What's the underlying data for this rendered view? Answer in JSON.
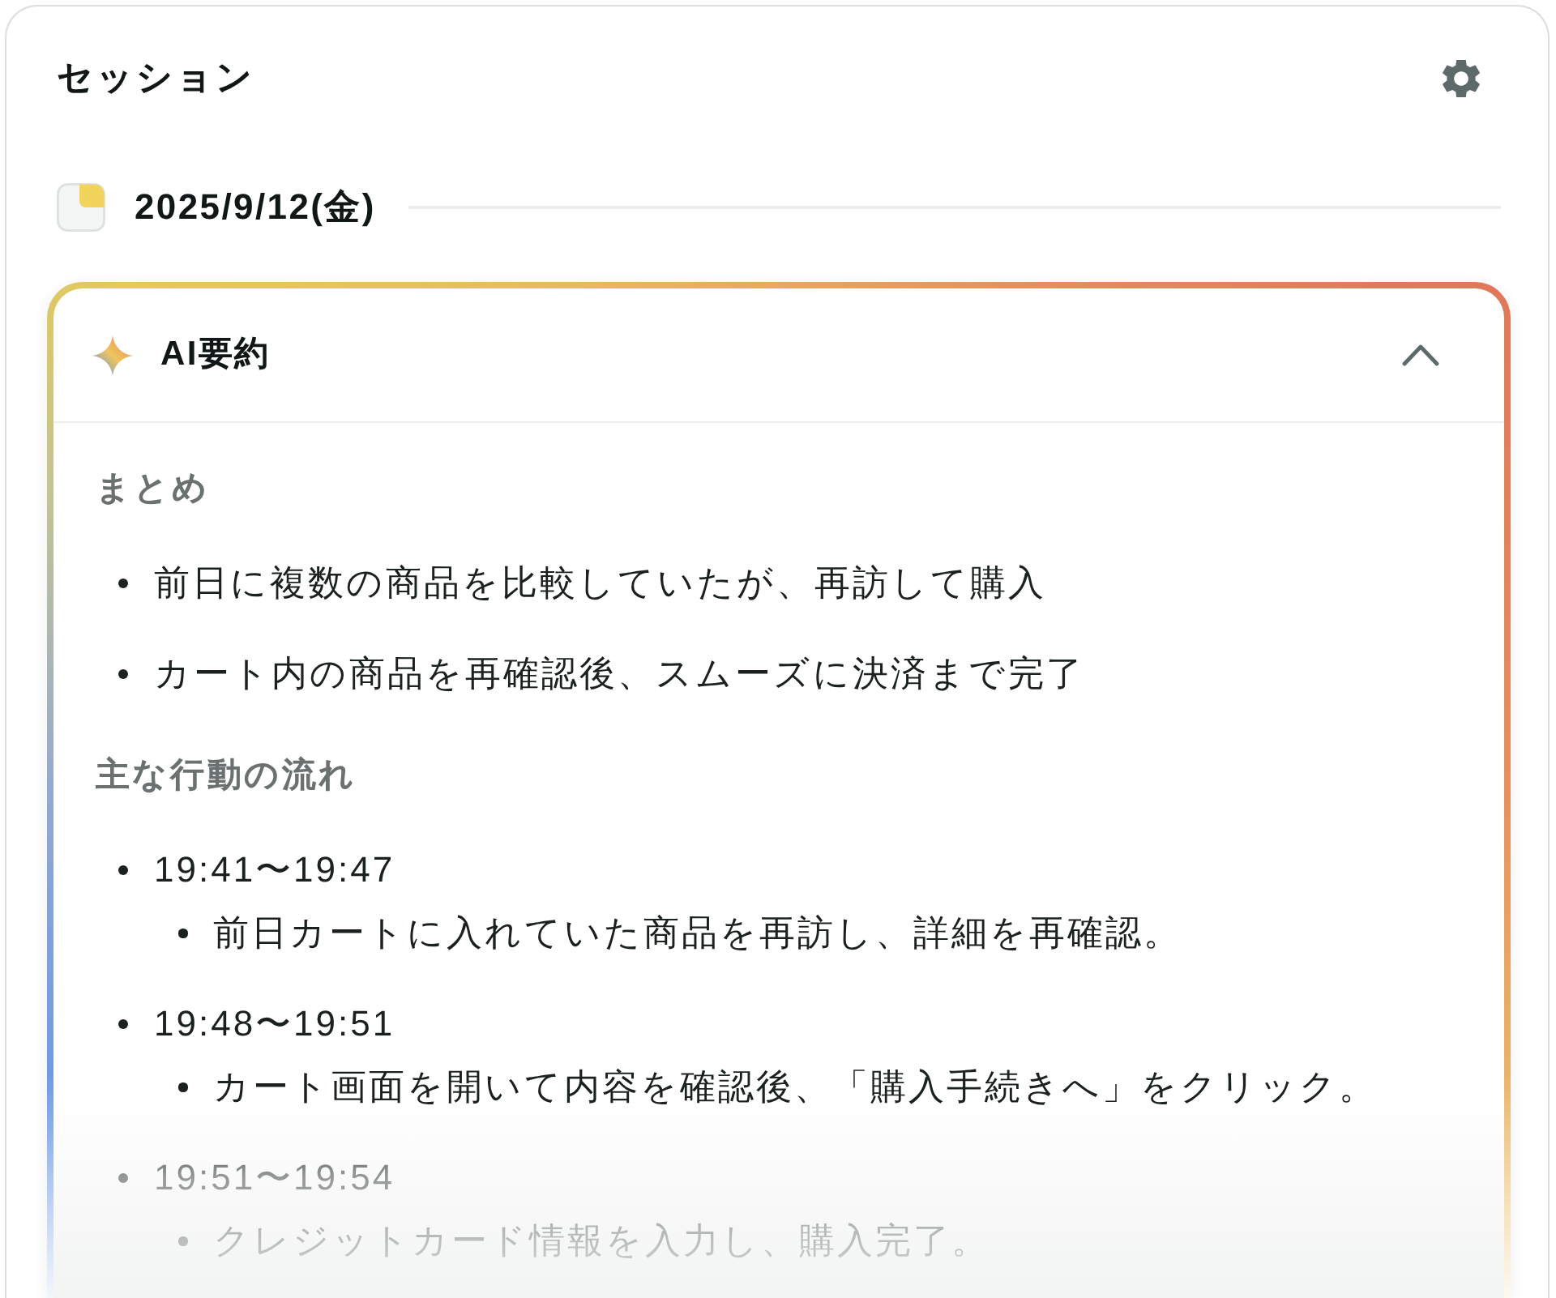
{
  "panel": {
    "title": "セッション"
  },
  "date_group": {
    "label": "2025/9/12(金)"
  },
  "ai_summary": {
    "title": "AI要約",
    "expanded": true,
    "sections": [
      {
        "heading": "まとめ",
        "items": [
          {
            "text": "前日に複数の商品を比較していたが、再訪して購入"
          },
          {
            "text": "カート内の商品を再確認後、スムーズに決済まで完了"
          }
        ]
      },
      {
        "heading": "主な行動の流れ",
        "items": [
          {
            "text": "19:41〜19:47",
            "children": [
              {
                "text": "前日カートに入れていた商品を再訪し、詳細を再確認。"
              }
            ]
          },
          {
            "text": "19:48〜19:51",
            "children": [
              {
                "text": "カート画面を開いて内容を確認後、「購入手続きへ」をクリック。"
              }
            ]
          },
          {
            "text": "19:51〜19:54",
            "children": [
              {
                "text": "クレジットカード情報を入力し、購入完了。"
              }
            ]
          }
        ]
      }
    ]
  }
}
